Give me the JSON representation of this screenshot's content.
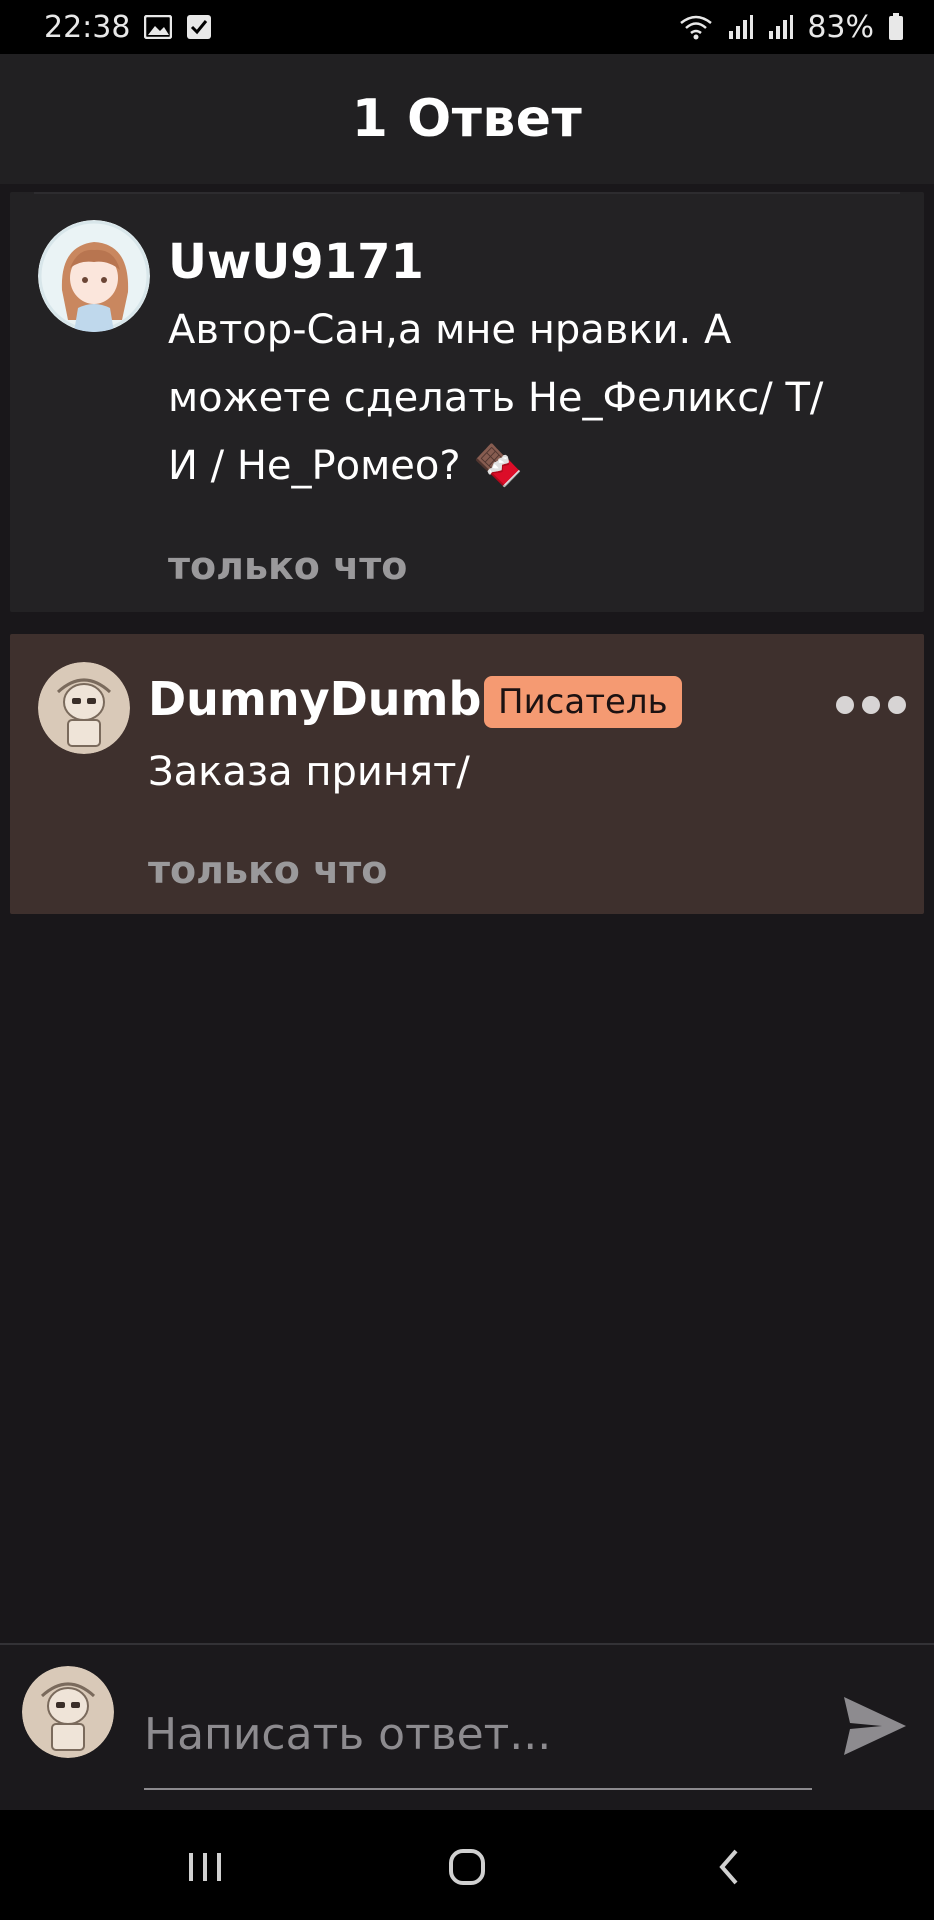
{
  "status_bar": {
    "time": "22:38",
    "battery": "83%",
    "icons": [
      "image-icon",
      "check-icon",
      "wifi-icon",
      "signal-icon",
      "signal-icon",
      "battery-icon"
    ]
  },
  "header": {
    "title": "1 Ответ"
  },
  "comments": [
    {
      "username": "UwU9171",
      "text_lines": [
        "Автор-Сан,а мне нравки. А",
        "можете сделать Не_Феликс/ Т/",
        "И / Не_Ромео? 🍫"
      ],
      "time": "только что"
    },
    {
      "username": "DumnyDumb",
      "badge": "Писатель",
      "text_lines": [
        "Заказа принят/"
      ],
      "time": "только что"
    }
  ],
  "composer": {
    "placeholder": "Написать ответ..."
  },
  "colors": {
    "background": "#19171a",
    "header": "#212022",
    "highlight_comment": "#3e302d",
    "badge": "#f59a72"
  }
}
